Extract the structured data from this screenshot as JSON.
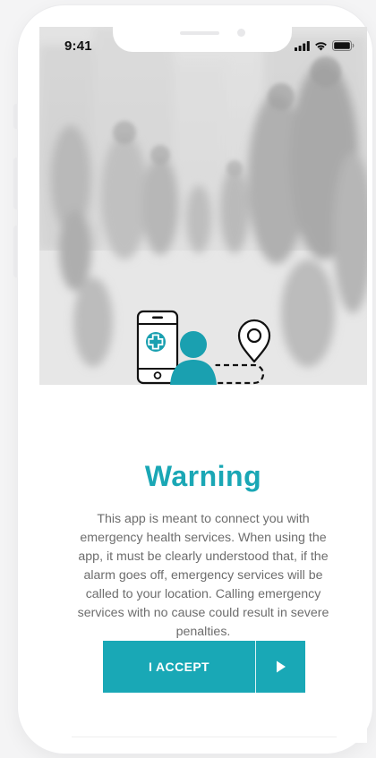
{
  "status_bar": {
    "time": "9:41",
    "icons": [
      "signal-icon",
      "wifi-icon",
      "battery-icon"
    ]
  },
  "hero": {
    "background": "blurred-crowd-photo",
    "illustration_icons": [
      "phone-medical-cross-icon",
      "person-icon",
      "dashed-route-icon",
      "location-pin-icon"
    ]
  },
  "warning": {
    "title": "Warning",
    "message": "This app is meant to connect you with emergency health services. When using the app, it must be clearly understood that, if the alarm goes off, emergency services will be called to your location. Calling emergency services with no cause could result in severe penalties."
  },
  "accept_button": {
    "label": "I ACCEPT",
    "icon": "play-arrow-icon"
  },
  "colors": {
    "accent": "#19a8b6",
    "text": "#6d6d6d",
    "illustration_teal": "#1aa0b0"
  }
}
